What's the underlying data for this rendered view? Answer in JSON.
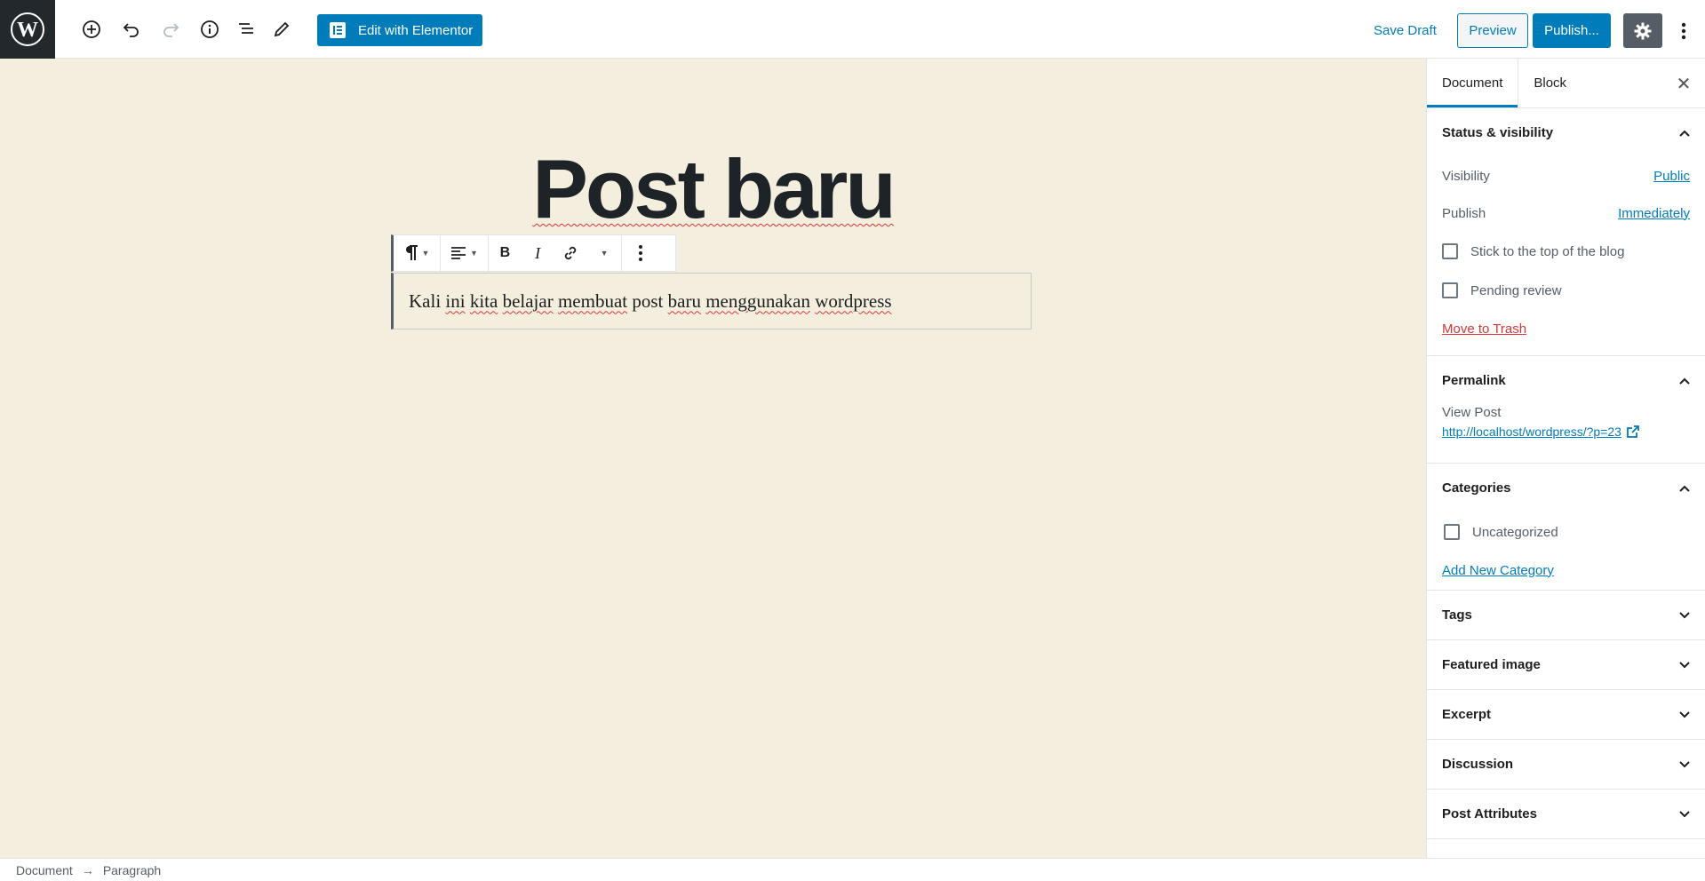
{
  "toolbar": {
    "elementor_label": "Edit with Elementor",
    "save_draft_label": "Save Draft",
    "preview_label": "Preview",
    "publish_label": "Publish..."
  },
  "editor": {
    "title": "Post baru",
    "paragraph_words": [
      "Kali",
      "ini",
      "kita",
      "belajar",
      "membuat",
      "post",
      "baru",
      "menggunakan",
      "wordpress"
    ]
  },
  "sidebar": {
    "tabs": [
      "Document",
      "Block"
    ],
    "status": {
      "heading": "Status & visibility",
      "visibility_label": "Visibility",
      "visibility_value": "Public",
      "publish_label": "Publish",
      "publish_value": "Immediately",
      "stick_label": "Stick to the top of the blog",
      "pending_label": "Pending review",
      "trash_label": "Move to Trash"
    },
    "permalink": {
      "heading": "Permalink",
      "view_label": "View Post",
      "url": "http://localhost/wordpress/?p=23"
    },
    "categories": {
      "heading": "Categories",
      "item": "Uncategorized",
      "add_label": "Add New Category"
    },
    "collapsed_panels": [
      "Tags",
      "Featured image",
      "Excerpt",
      "Discussion",
      "Post Attributes"
    ]
  },
  "footer": {
    "crumb_root": "Document",
    "separator": "→",
    "crumb_current": "Paragraph"
  },
  "colors": {
    "accent": "#007cba",
    "canvas_bg": "#f4eedf",
    "danger": "#d63638",
    "dark": "#23282d"
  }
}
